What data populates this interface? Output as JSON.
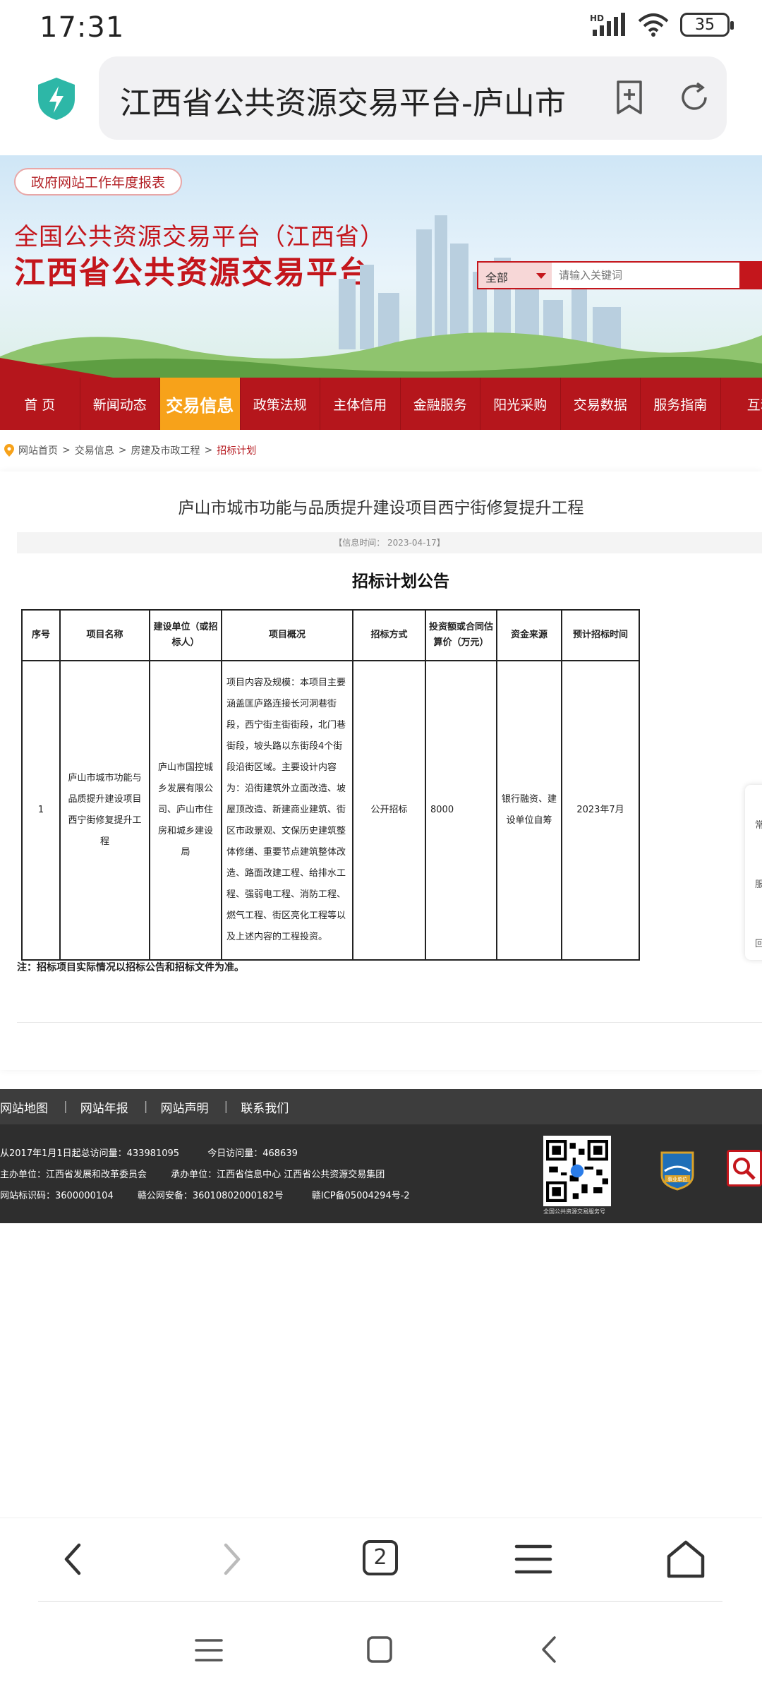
{
  "status": {
    "time": "17:31",
    "network": "HD",
    "battery": "35"
  },
  "address": {
    "title": "江西省公共资源交易平台-庐山市"
  },
  "banner": {
    "report_link": "政府网站工作年度报表",
    "title_line1": "全国公共资源交易平台（江西省）",
    "title_line2": "江西省公共资源交易平台",
    "search_scope": "全部",
    "search_placeholder": "请输入关键词"
  },
  "nav": {
    "items": [
      "首 页",
      "新闻动态",
      "交易信息",
      "政策法规",
      "主体信用",
      "金融服务",
      "阳光采购",
      "交易数据",
      "服务指南",
      "互动"
    ],
    "active_index": 2
  },
  "breadcrumb": {
    "items": [
      "网站首页",
      "交易信息",
      "房建及市政工程"
    ],
    "current": "招标计划"
  },
  "article": {
    "title": "庐山市城市功能与品质提升建设项目西宁街修复提升工程",
    "meta": "【信息时间： 2023-04-17】",
    "subtitle": "招标计划公告",
    "table": {
      "headers": [
        "序号",
        "项目名称",
        "建设单位（或招标人）",
        "项目概况",
        "招标方式",
        "投资额或合同估算价（万元）",
        "资金来源",
        "预计招标时间"
      ],
      "rows": [
        [
          "1",
          "庐山市城市功能与品质提升建设项目西宁街修复提升工程",
          "庐山市国控城乡发展有限公司、庐山市住房和城乡建设局",
          "项目内容及规模：本项目主要涵盖匡庐路连接长河洞巷街段，西宁街主街街段，北门巷街段，坡头路以东街段4个街段沿街区域。主要设计内容为：沿街建筑外立面改造、坡屋顶改造、新建商业建筑、街区市政景观、文保历史建筑整体修缮、重要节点建筑整体改造、路面改建工程、给排水工程、强弱电工程、消防工程、燃气工程、街区亮化工程等以及上述内容的工程投资。",
          "公开招标",
          "8000",
          "银行融资、建设单位自筹",
          "2023年7月"
        ]
      ]
    },
    "note": "注：招标项目实际情况以招标公告和招标文件为准。"
  },
  "side_tool": [
    "常",
    "服",
    "回"
  ],
  "footer": {
    "links": [
      "网站地图",
      "网站年报",
      "网站声明",
      "联系我们"
    ],
    "visits_total": "从2017年1月1日起总访问量：433981095",
    "visits_today": "今日访问量：468639",
    "host": "主办单位：江西省发展和改革委员会",
    "organizer": "承办单位：江西省信息中心 江西省公共资源交易集团",
    "site_code": "网站标识码：3600000104",
    "police_record": "赣公网安备：36010802000182号",
    "icp": "赣ICP备05004294号-2",
    "qr_caption": "全国公共资源交易服务号",
    "badge_label": "事业单位"
  },
  "toolbar": {
    "tab_count": "2"
  },
  "colors": {
    "brand_red": "#b5161c",
    "active_orange": "#f7a21a",
    "footer_dark": "#2e2e2e"
  }
}
